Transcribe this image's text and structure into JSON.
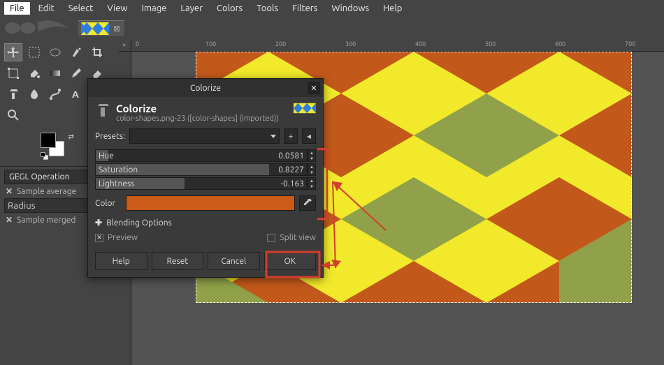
{
  "menu": {
    "items": [
      "File",
      "Edit",
      "Select",
      "View",
      "Image",
      "Layer",
      "Colors",
      "Tools",
      "Filters",
      "Windows",
      "Help"
    ]
  },
  "tab": {
    "close_glyph": "⊠"
  },
  "ruler": {
    "ticks": [
      "0",
      "100",
      "200",
      "300",
      "400",
      "500",
      "600",
      "700"
    ]
  },
  "dockable": {
    "title": "GEGL Operation",
    "sample_average": "Sample average",
    "radius_label": "Radius",
    "sample_merged": "Sample merged"
  },
  "dialog": {
    "title": "Colorize",
    "heading": "Colorize",
    "subheading": "color-shapes.png-23 ([color-shapes] (imported))",
    "presets_label": "Presets:",
    "sliders": {
      "hue": {
        "label": "Hue",
        "value": "0.0581",
        "frac": 0.06
      },
      "saturation": {
        "label": "Saturation",
        "value": "0.8227",
        "frac": 0.82
      },
      "lightness": {
        "label": "Lightness",
        "value": "-0.163",
        "frac": 0.42
      }
    },
    "color_label": "Color",
    "color_hex": "#cc5a19",
    "blending": "Blending Options",
    "preview": "Preview",
    "split": "Split view",
    "buttons": {
      "help": "Help",
      "reset": "Reset",
      "cancel": "Cancel",
      "ok": "OK"
    }
  },
  "argyle": {
    "bg": "#f1e92a",
    "d1": "#c2591a",
    "d2": "#90a149"
  }
}
